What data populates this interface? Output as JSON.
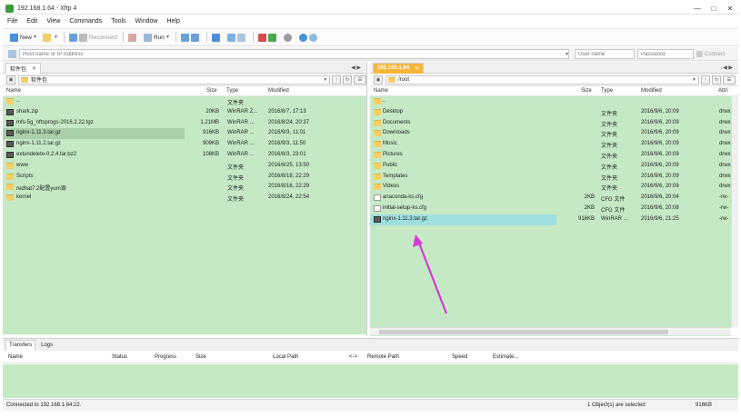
{
  "window": {
    "title": "192.168.1.64 - Xftp 4"
  },
  "menu": [
    "File",
    "Edit",
    "View",
    "Commands",
    "Tools",
    "Window",
    "Help"
  ],
  "toolbar": {
    "new_label": "New",
    "reconnect_label": "Reconnect",
    "run_label": "Run"
  },
  "address": {
    "host_placeholder": "Host name or IP Address",
    "user_placeholder": "User name",
    "password_placeholder": "Password",
    "connect_label": "Connect"
  },
  "local": {
    "tab_label": "软件包",
    "path": "软件包",
    "columns": {
      "name": "Name",
      "size": "Size",
      "type": "Type",
      "modified": "Modified"
    },
    "files": [
      {
        "name": "..",
        "size": "",
        "type": "文件夹",
        "modified": "",
        "icon": "folder-icon"
      },
      {
        "name": "shark.zip",
        "size": "20KB",
        "type": "WinRAR Z...",
        "modified": "2016/8/7, 17:13",
        "icon": "archive-icon"
      },
      {
        "name": "mfs-5g_nftsprogs-2016.2.22.tgz",
        "size": "1.21MB",
        "type": "WinRAR ...",
        "modified": "2016/8/24, 20:37",
        "icon": "archive-icon"
      },
      {
        "name": "nginx-1.11.3.tar.gz",
        "size": "916KB",
        "type": "WinRAR ...",
        "modified": "2016/9/3, 11:01",
        "icon": "archive-icon"
      },
      {
        "name": "nginx-1.11.2.tar.gz",
        "size": "909KB",
        "type": "WinRAR ...",
        "modified": "2016/9/3, 11:50",
        "icon": "archive-icon"
      },
      {
        "name": "extundelete-0.2.4.tar.bz2",
        "size": "108KB",
        "type": "WinRAR ...",
        "modified": "2016/8/3, 23:01",
        "icon": "archive-icon"
      },
      {
        "name": "www",
        "size": "",
        "type": "文件夹",
        "modified": "2016/8/25, 13:50",
        "icon": "folder-icon"
      },
      {
        "name": "Scripts",
        "size": "",
        "type": "文件夹",
        "modified": "2016/8/18, 22:29",
        "icon": "folder-icon"
      },
      {
        "name": "redhat7.2配置yum源",
        "size": "",
        "type": "文件夹",
        "modified": "2016/8/18, 22:29",
        "icon": "folder-icon"
      },
      {
        "name": "kernel",
        "size": "",
        "type": "文件夹",
        "modified": "2016/8/24, 22:54",
        "icon": "folder-icon"
      }
    ]
  },
  "remote": {
    "tab_label": "192.168.1.64",
    "path": "/root",
    "columns": {
      "name": "Name",
      "size": "Size",
      "type": "Type",
      "modified": "Modified",
      "attr": "Attri"
    },
    "files": [
      {
        "name": "..",
        "size": "",
        "type": "",
        "modified": "",
        "attr": "",
        "icon": "folder-icon"
      },
      {
        "name": "Desktop",
        "size": "",
        "type": "文件夹",
        "modified": "2016/9/6, 20:09",
        "attr": "drwx",
        "icon": "folder-icon"
      },
      {
        "name": "Documents",
        "size": "",
        "type": "文件夹",
        "modified": "2016/9/6, 20:09",
        "attr": "drwx",
        "icon": "folder-icon"
      },
      {
        "name": "Downloads",
        "size": "",
        "type": "文件夹",
        "modified": "2016/9/6, 20:09",
        "attr": "drwx",
        "icon": "folder-icon"
      },
      {
        "name": "Music",
        "size": "",
        "type": "文件夹",
        "modified": "2016/9/6, 20:09",
        "attr": "drwx",
        "icon": "folder-icon"
      },
      {
        "name": "Pictures",
        "size": "",
        "type": "文件夹",
        "modified": "2016/9/6, 20:09",
        "attr": "drwx",
        "icon": "folder-icon"
      },
      {
        "name": "Public",
        "size": "",
        "type": "文件夹",
        "modified": "2016/9/6, 20:09",
        "attr": "drwx",
        "icon": "folder-icon"
      },
      {
        "name": "Templates",
        "size": "",
        "type": "文件夹",
        "modified": "2016/9/6, 20:09",
        "attr": "drwx",
        "icon": "folder-icon"
      },
      {
        "name": "Videos",
        "size": "",
        "type": "文件夹",
        "modified": "2016/9/6, 20:09",
        "attr": "drwx",
        "icon": "folder-icon"
      },
      {
        "name": "anaconda-ks.cfg",
        "size": "2KB",
        "type": "CFG 文件",
        "modified": "2016/9/6, 20:04",
        "attr": "-rw-",
        "icon": "file-icon"
      },
      {
        "name": "initial-setup-ks.cfg",
        "size": "2KB",
        "type": "CFG 文件",
        "modified": "2016/9/6, 20:08",
        "attr": "-rw-",
        "icon": "file-icon"
      },
      {
        "name": "nginx-1.11.3.tar.gz",
        "size": "916KB",
        "type": "WinRAR ...",
        "modified": "2016/9/6, 21:25",
        "attr": "-rw-",
        "icon": "archive-icon"
      }
    ]
  },
  "transfers": {
    "tabs": [
      "Transfers",
      "Logs"
    ],
    "columns": [
      "Name",
      "Status",
      "Progress",
      "Size",
      "Local Path",
      "<->",
      "Remote Path",
      "Speed",
      "Estimate..."
    ]
  },
  "status": {
    "left": "Connected to 192.168.1.64:22.",
    "center": "1 Object(s) are selected",
    "right": "916KB"
  },
  "colors": {
    "list_bg": "#c5e9c5",
    "remote_tab": "#f7b53a",
    "annotation_arrow": "#d63ad6"
  }
}
